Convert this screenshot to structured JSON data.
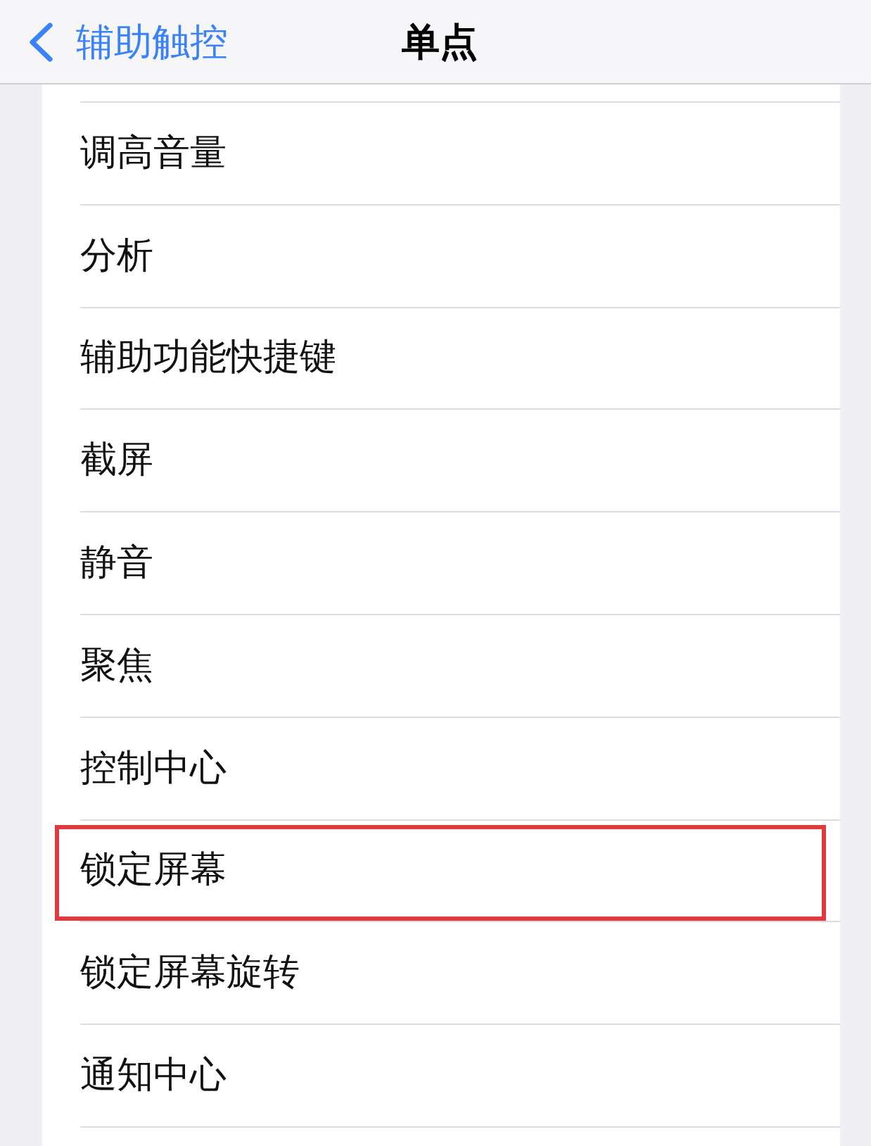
{
  "nav_bar": {
    "back_label": "辅助触控",
    "title": "单点"
  },
  "items": [
    {
      "label": "调高音量",
      "highlighted": false
    },
    {
      "label": "分析",
      "highlighted": false
    },
    {
      "label": "辅助功能快捷键",
      "highlighted": false
    },
    {
      "label": "截屏",
      "highlighted": false
    },
    {
      "label": "静音",
      "highlighted": false
    },
    {
      "label": "聚焦",
      "highlighted": false
    },
    {
      "label": "控制中心",
      "highlighted": false
    },
    {
      "label": "锁定屏幕",
      "highlighted": true
    },
    {
      "label": "锁定屏幕旋转",
      "highlighted": false
    },
    {
      "label": "通知中心",
      "highlighted": false
    }
  ]
}
